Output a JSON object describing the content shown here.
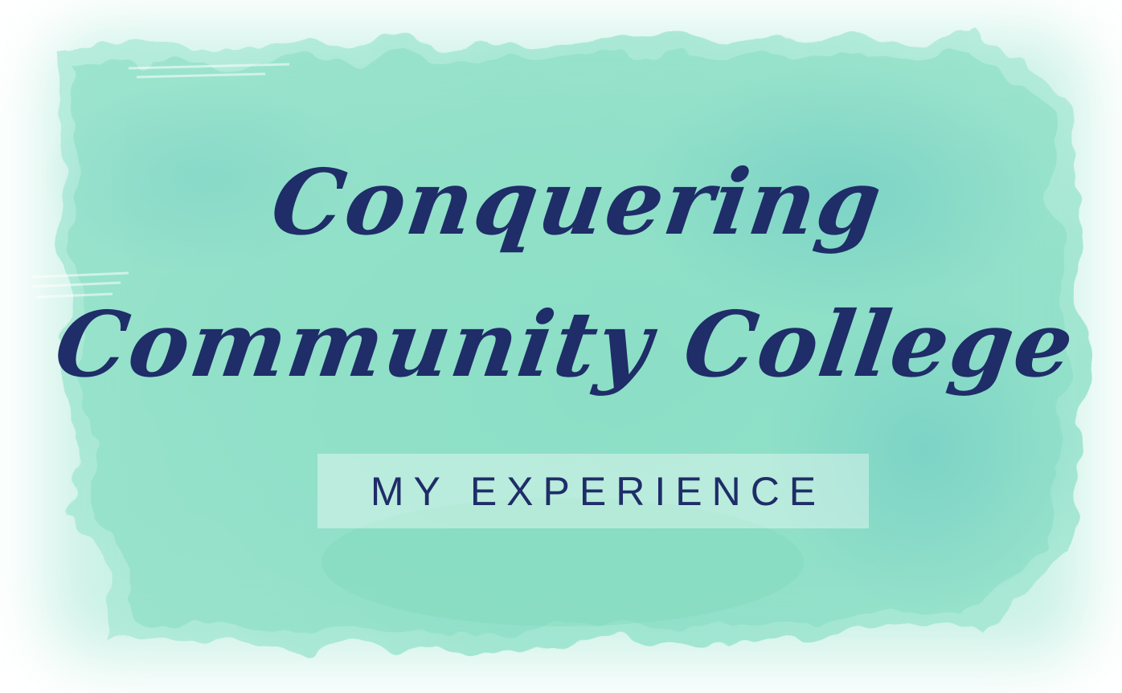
{
  "title": {
    "line1": "Conquering",
    "line2": "Community College"
  },
  "subtitle": "MY EXPERIENCE",
  "colors": {
    "background": "#ffffff",
    "wash_light": "#bfeee0",
    "wash_mid": "#7fdcc0",
    "wash_deep": "#5cc9b3",
    "text": "#1f2d68"
  }
}
